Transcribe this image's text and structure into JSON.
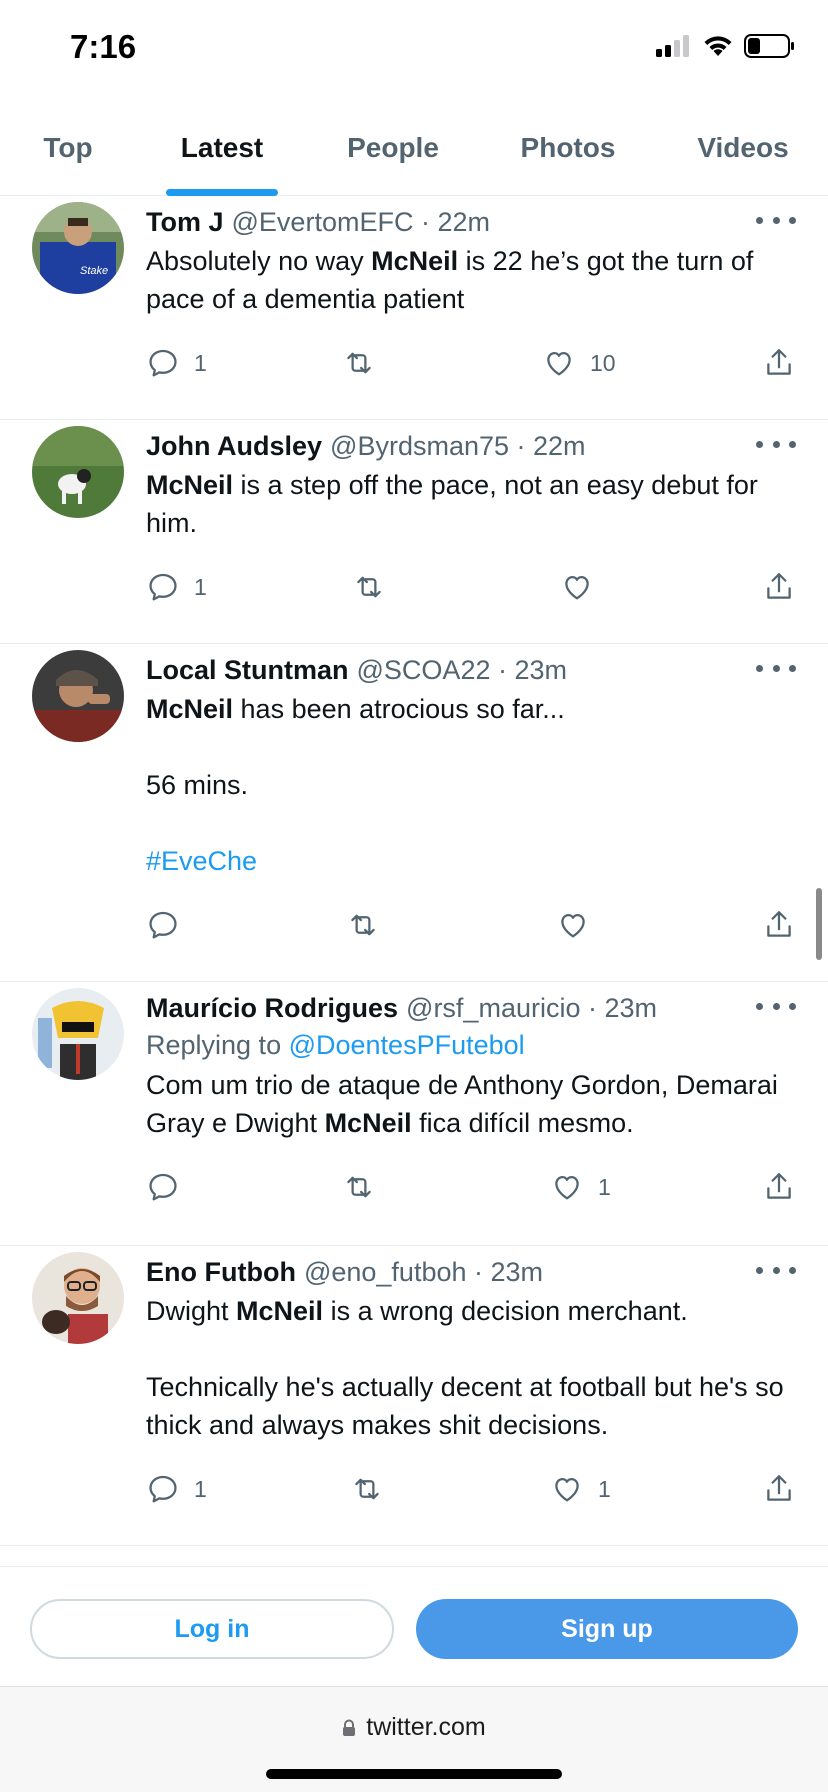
{
  "status_bar": {
    "time": "7:16"
  },
  "tabs": [
    {
      "label": "Top",
      "active": false
    },
    {
      "label": "Latest",
      "active": true
    },
    {
      "label": "People",
      "active": false
    },
    {
      "label": "Photos",
      "active": false
    },
    {
      "label": "Videos",
      "active": false
    }
  ],
  "tweets": [
    {
      "name": "Tom J",
      "handle": "@EvertomEFC · 22m",
      "text_parts": [
        {
          "t": "Absolutely no way "
        },
        {
          "b": "McNeil"
        },
        {
          "t": " is 22 he’s got the turn of pace of a dementia patient"
        }
      ],
      "replies": "1",
      "retweets": "",
      "likes": "10"
    },
    {
      "name": "John Audsley",
      "handle": "@Byrdsman75 · 22m",
      "text_parts": [
        {
          "b": "McNeil"
        },
        {
          "t": " is a step off the pace, not an easy debut for him."
        }
      ],
      "replies": "1",
      "retweets": "",
      "likes": ""
    },
    {
      "name": "Local Stuntman",
      "handle": "@SCOA22 · 23m",
      "line1_bold": "McNeil",
      "line1_rest": " has been atrocious so far...",
      "line2": "56 mins.",
      "hashtag": "#EveChe",
      "replies": "",
      "retweets": "",
      "likes": ""
    },
    {
      "name": "Maurício Rodrigues",
      "handle": "@rsf_mauricio · 23m",
      "replying_label": "Replying to ",
      "replying_to": "@DoentesPFutebol",
      "text_before": "Com um trio de ataque de Anthony Gordon, Demarai Gray e Dwight ",
      "text_bold": "McNeil",
      "text_after": " fica difícil mesmo.",
      "replies": "",
      "retweets": "",
      "likes": "1"
    },
    {
      "name": "Eno Futboh",
      "handle": "@eno_futboh · 23m",
      "line1_before": "Dwight ",
      "line1_bold": "McNeil",
      "line1_after": " is a wrong decision merchant.",
      "line2": "Technically he's actually decent at football but he's so thick and always makes shit decisions.",
      "replies": "1",
      "retweets": "",
      "likes": "1"
    }
  ],
  "bottom": {
    "login": "Log in",
    "signup": "Sign up"
  },
  "browser": {
    "url": "twitter.com"
  },
  "colors": {
    "accent": "#1d9bf0",
    "signup_bg": "#4a99e9",
    "muted": "#536471"
  }
}
